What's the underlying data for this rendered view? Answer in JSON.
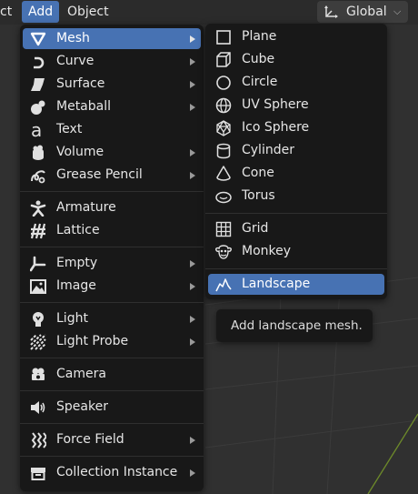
{
  "header": {
    "menus": [
      {
        "label": "ct"
      },
      {
        "label": "Add"
      },
      {
        "label": "Object"
      }
    ],
    "orientation": {
      "label": "Global",
      "icon": "global-orientation-icon"
    }
  },
  "add_menu": {
    "items": [
      {
        "label": "Mesh",
        "icon": "mesh-icon",
        "submenu": true,
        "active": true
      },
      {
        "label": "Curve",
        "icon": "curve-icon",
        "submenu": true
      },
      {
        "label": "Surface",
        "icon": "surface-icon",
        "submenu": true
      },
      {
        "label": "Metaball",
        "icon": "metaball-icon",
        "submenu": true
      },
      {
        "label": "Text",
        "icon": "text-icon",
        "submenu": false
      },
      {
        "label": "Volume",
        "icon": "volume-icon",
        "submenu": true
      },
      {
        "label": "Grease Pencil",
        "icon": "grease-pencil-icon",
        "submenu": true
      },
      {
        "label": "Armature",
        "icon": "armature-icon",
        "submenu": false
      },
      {
        "label": "Lattice",
        "icon": "lattice-icon",
        "submenu": false
      },
      {
        "label": "Empty",
        "icon": "empty-icon",
        "submenu": true
      },
      {
        "label": "Image",
        "icon": "image-icon",
        "submenu": true
      },
      {
        "label": "Light",
        "icon": "light-icon",
        "submenu": true
      },
      {
        "label": "Light Probe",
        "icon": "light-probe-icon",
        "submenu": true
      },
      {
        "label": "Camera",
        "icon": "camera-icon",
        "submenu": false
      },
      {
        "label": "Speaker",
        "icon": "speaker-icon",
        "submenu": false
      },
      {
        "label": "Force Field",
        "icon": "force-field-icon",
        "submenu": true
      },
      {
        "label": "Collection Instance",
        "icon": "collection-instance-icon",
        "submenu": true
      }
    ]
  },
  "mesh_menu": {
    "items": [
      {
        "label": "Plane",
        "icon": "plane-icon"
      },
      {
        "label": "Cube",
        "icon": "cube-icon"
      },
      {
        "label": "Circle",
        "icon": "circle-icon"
      },
      {
        "label": "UV Sphere",
        "icon": "uv-sphere-icon"
      },
      {
        "label": "Ico Sphere",
        "icon": "ico-sphere-icon"
      },
      {
        "label": "Cylinder",
        "icon": "cylinder-icon"
      },
      {
        "label": "Cone",
        "icon": "cone-icon"
      },
      {
        "label": "Torus",
        "icon": "torus-icon"
      },
      {
        "label": "Grid",
        "icon": "grid-icon"
      },
      {
        "label": "Monkey",
        "icon": "monkey-icon"
      },
      {
        "label": "Landscape",
        "icon": "landscape-icon",
        "active": true
      }
    ]
  },
  "tooltip": {
    "text": "Add landscape mesh."
  },
  "colors": {
    "accent": "#4772b3",
    "menu_bg": "#181818",
    "viewport_bg": "#303030"
  }
}
